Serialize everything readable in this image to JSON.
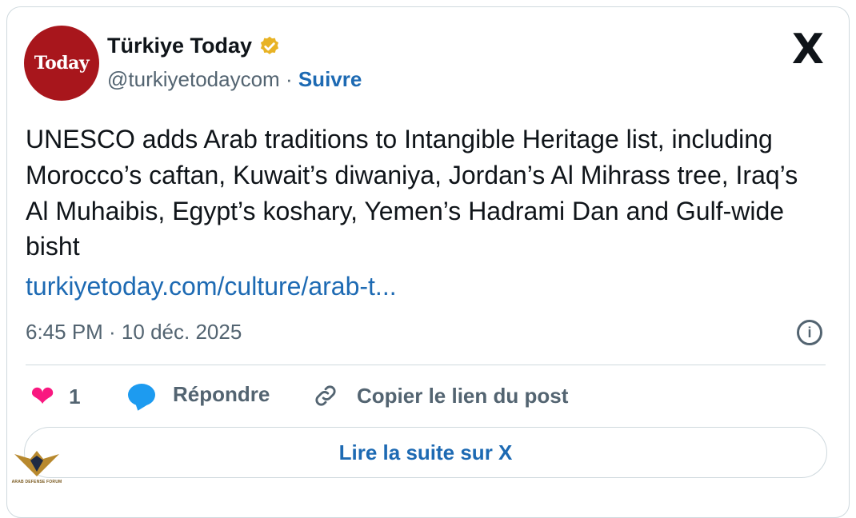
{
  "account": {
    "name": "Türkiye Today",
    "handle": "@turkiyetodaycom",
    "separator": "·",
    "follow_label": "Suivre",
    "avatar_text": "Today"
  },
  "platform_logo": "X",
  "post": {
    "text": "UNESCO adds Arab traditions to Intangible Heritage list, including Morocco’s caftan, Kuwait’s diwaniya, Jordan’s Al Mihrass tree, Iraq’s Al Muhaibis, Egypt’s koshary, Yemen’s Hadrami Dan and Gulf-wide bisht",
    "link": "turkiyetoday.com/culture/arab-t...",
    "timestamp": "6:45 PM · 10 déc. 2025"
  },
  "actions": {
    "like_count": "1",
    "reply_label": "Répondre",
    "copy_link_label": "Copier le lien du post"
  },
  "read_more_label": "Lire la suite sur X",
  "watermark": {
    "line1": "ARAB DEFENSE FORUM"
  },
  "colors": {
    "link_blue": "#1d6ab3",
    "heart_pink": "#f91880",
    "reply_blue": "#1d9bf0",
    "avatar_red": "#a8161c",
    "verified_gold": "#e8b325"
  }
}
